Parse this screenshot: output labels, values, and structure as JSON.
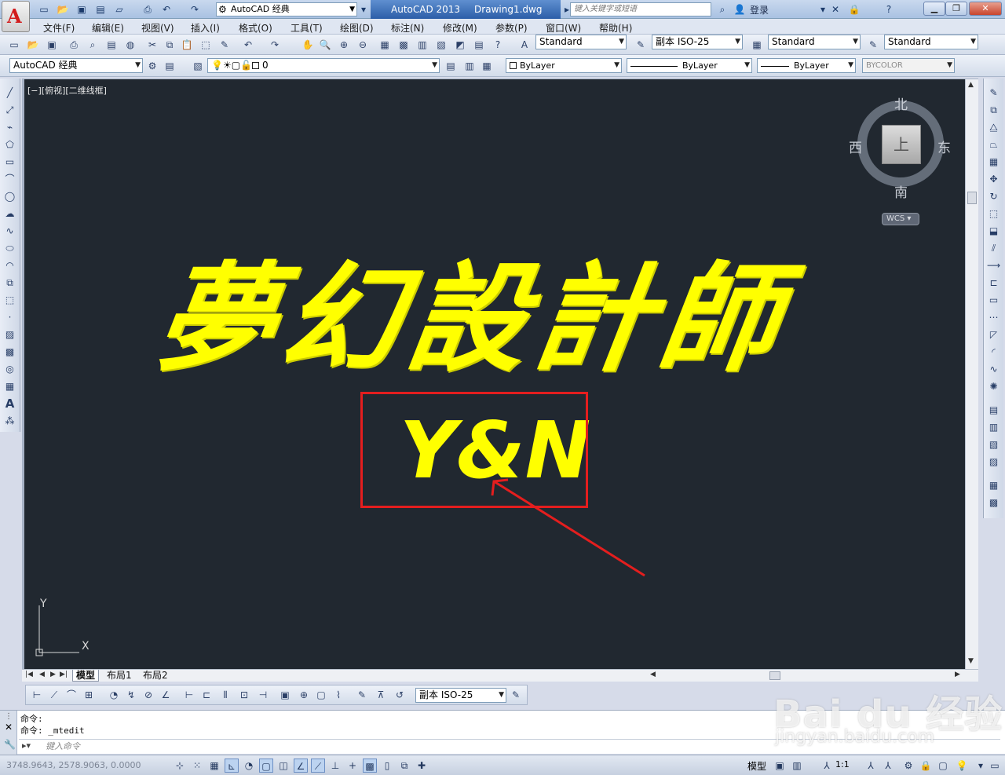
{
  "titlebar": {
    "logo_letter": "A",
    "workspace": "AutoCAD 经典",
    "app_name": "AutoCAD 2013",
    "document": "Drawing1.dwg",
    "search_placeholder": "键入关键字或短语",
    "login": "登录",
    "help": "?"
  },
  "menu": [
    "文件(F)",
    "编辑(E)",
    "视图(V)",
    "插入(I)",
    "格式(O)",
    "工具(T)",
    "绘图(D)",
    "标注(N)",
    "修改(M)",
    "参数(P)",
    "窗口(W)",
    "帮助(H)"
  ],
  "styles_toolbar": {
    "text_style": "Standard",
    "dim_style": "副本 ISO-25",
    "table_style": "Standard",
    "mleader_style": "Standard"
  },
  "layers_toolbar": {
    "workspace": "AutoCAD 经典",
    "layer": "0",
    "color": "ByLayer",
    "linetype": "ByLayer",
    "lineweight": "ByLayer",
    "plotstyle": "BYCOLOR"
  },
  "viewport": {
    "label": "[−][俯视][二维线框]",
    "compass": {
      "n": "北",
      "s": "南",
      "e": "东",
      "w": "西",
      "top": "上"
    },
    "wcs": "WCS ▾",
    "main_text": "夢幻設計師",
    "highlight_text": "Y&N",
    "ucs_x": "X",
    "ucs_y": "Y",
    "highlight_color": "#e41e1e",
    "text_color": "#ffff00"
  },
  "layout_tabs": [
    "模型",
    "布局1",
    "布局2"
  ],
  "dim_toolbar": {
    "dim_style": "副本 ISO-25"
  },
  "command": {
    "history": [
      "命令:",
      "命令: _mtedit"
    ],
    "placeholder": "键入命令"
  },
  "status": {
    "coords": "3748.9643, 2578.9063, 0.0000",
    "model": "模型",
    "scale": "1:1"
  },
  "watermark": {
    "main": "Bai du 经验",
    "sub": "jingyan.baidu.com"
  }
}
